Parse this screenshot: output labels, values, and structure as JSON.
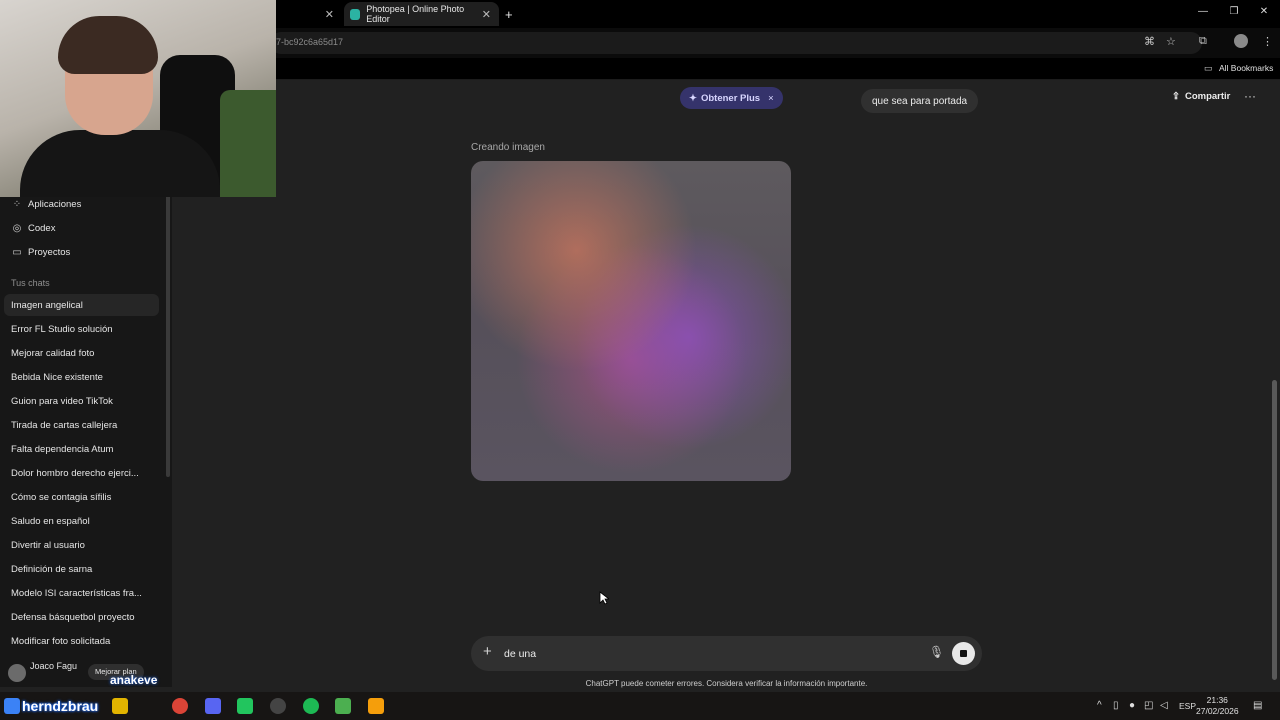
{
  "browser": {
    "tabs": [
      {
        "title": "",
        "active": false
      },
      {
        "title": "Photopea | Online Photo Editor",
        "active": false
      }
    ],
    "new_tab": "+",
    "url_fragment": "7-bc92c6a65d17",
    "bookmarks_label": "All Bookmarks"
  },
  "sidebar": {
    "top_items": [
      {
        "icon": "apps-icon",
        "label": "Aplicaciones"
      },
      {
        "icon": "codex-icon",
        "label": "Codex"
      },
      {
        "icon": "folder-icon",
        "label": "Proyectos"
      }
    ],
    "chats_heading": "Tus chats",
    "chats": [
      "Imagen angelical",
      "Error FL Studio solución",
      "Mejorar calidad foto",
      "Bebida Nice existente",
      "Guion para video TikTok",
      "Tirada de cartas callejera",
      "Falta dependencia Atum",
      "Dolor hombro derecho ejerci...",
      "Cómo se contagia sífilis",
      "Saludo en español",
      "Divertir al usuario",
      "Definición de sarna",
      "Modelo ISI características fra...",
      "Defensa básquetbol proyecto",
      "Modificar foto solicitada"
    ],
    "user_name": "Joaco Fagu",
    "upgrade_label": "Mejorar plan"
  },
  "header": {
    "plus_label": "Obtener Plus",
    "plus_close": "×",
    "share_label": "Compartir",
    "more": "···"
  },
  "conversation": {
    "user_message": "que sea para portada",
    "status_text": "Creando imagen"
  },
  "composer": {
    "value": "de una",
    "disclaimer": "ChatGPT puede cometer errores. Considera verificar la información importante."
  },
  "overlay": {
    "line1": "anakeve",
    "line2": "herndzbrau"
  },
  "taskbar": {
    "lang": "ESP",
    "time": "21:36",
    "date": "27/02/2026"
  },
  "colors": {
    "bg": "#212121",
    "sidebar": "#171717",
    "plus_pill": "#35336b",
    "bubble": "#303030"
  }
}
